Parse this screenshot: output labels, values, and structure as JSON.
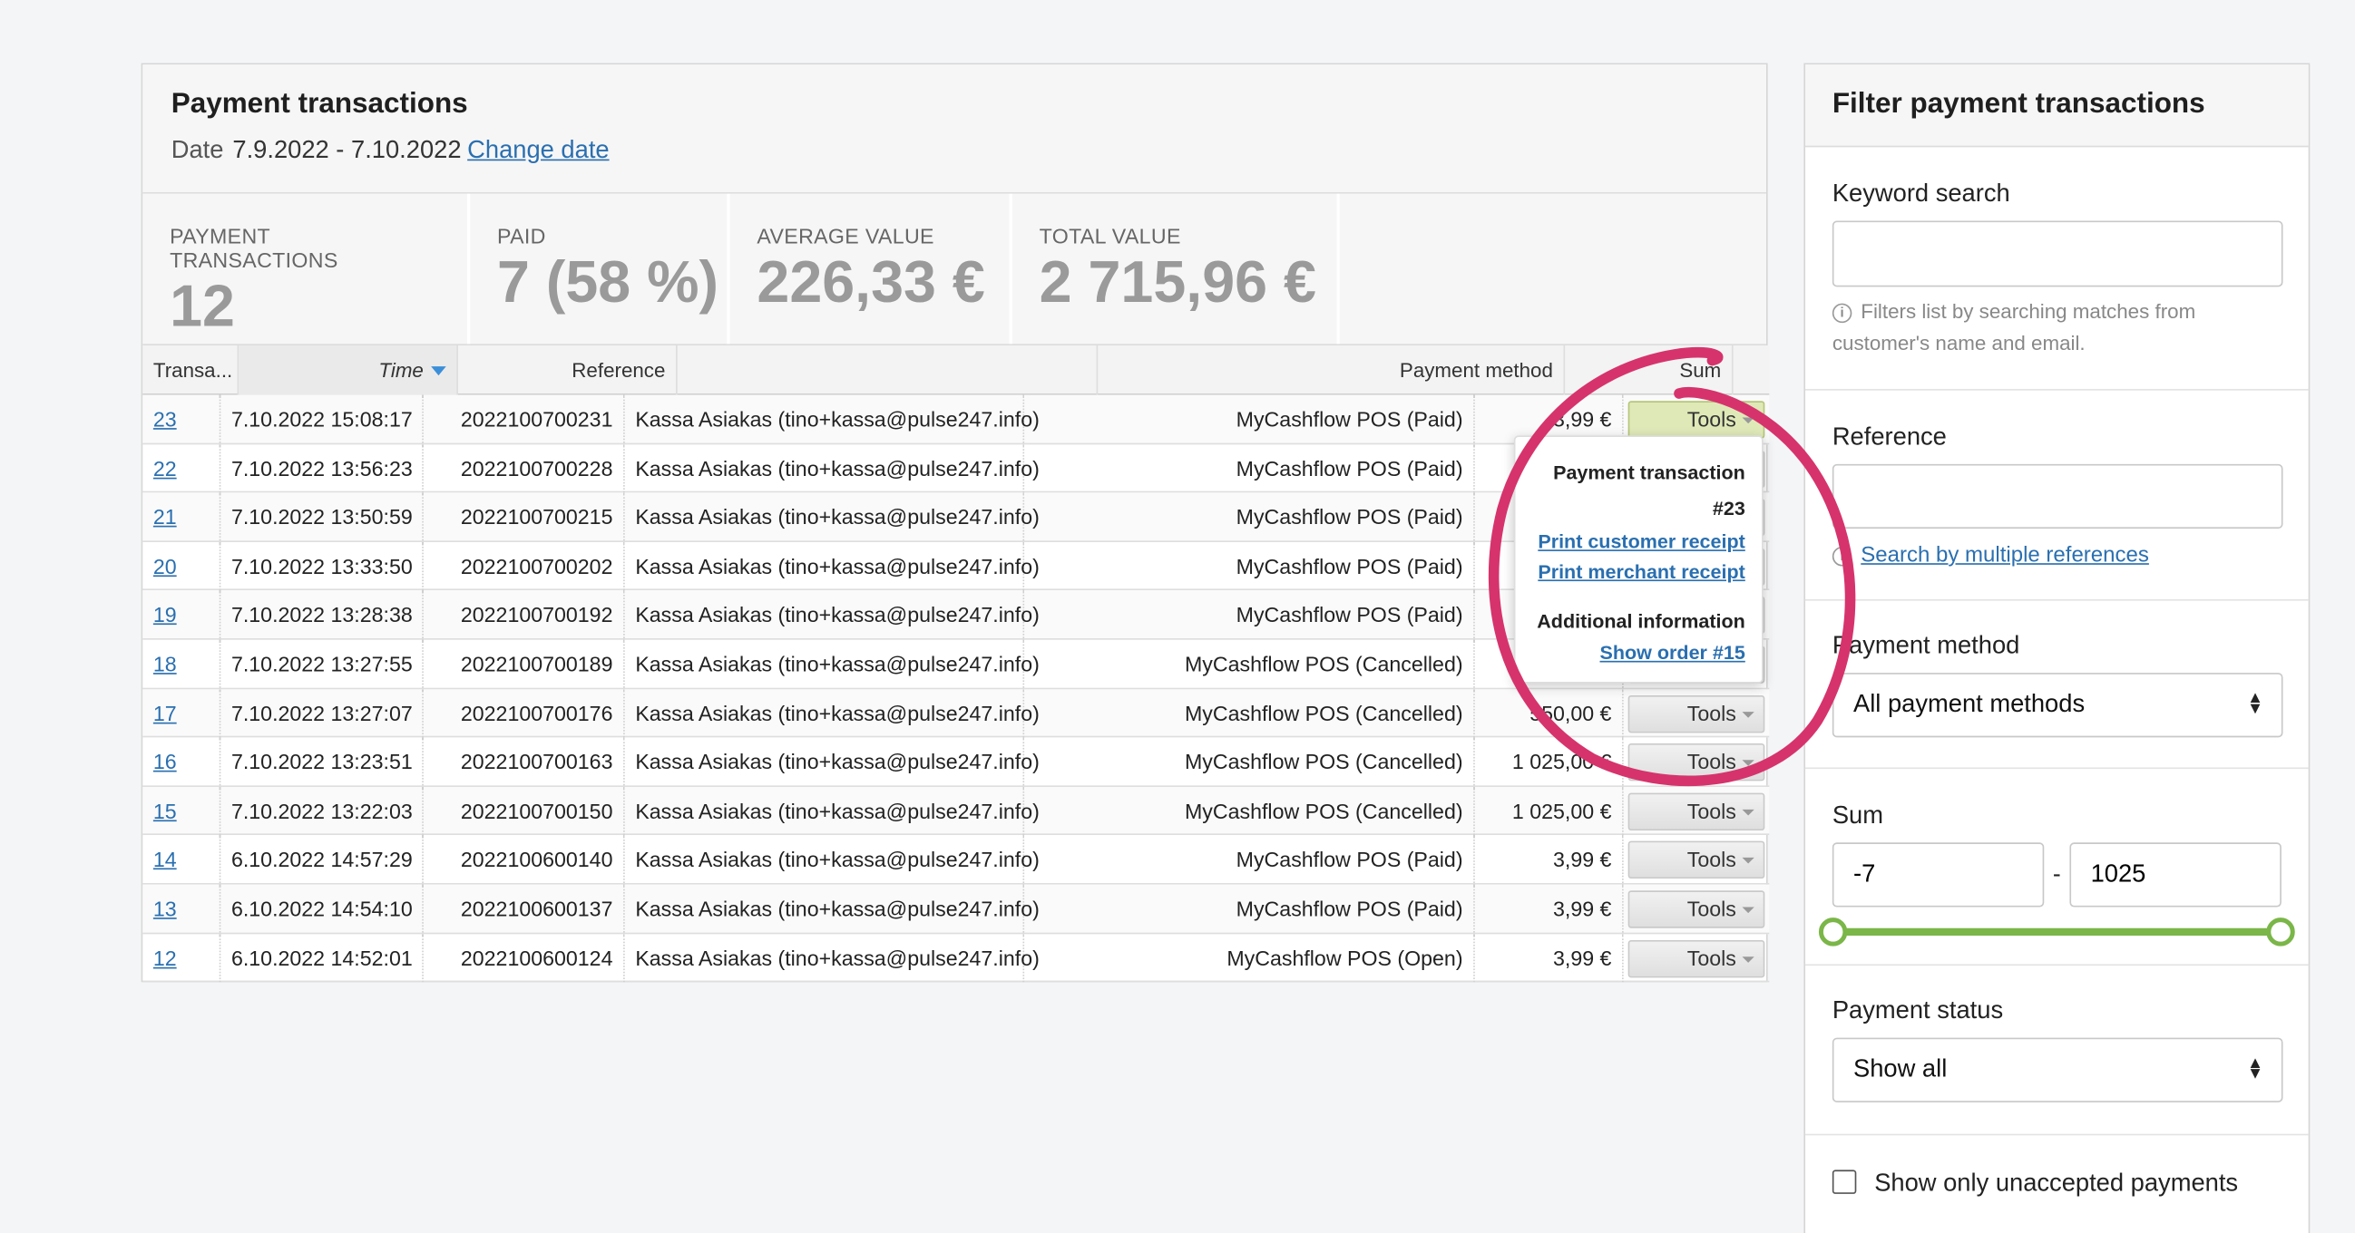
{
  "header": {
    "title": "Payment transactions",
    "date_label": "Date",
    "date_range": "7.9.2022 - 7.10.2022",
    "change_date": "Change date"
  },
  "stats": [
    {
      "label": "PAYMENT TRANSACTIONS",
      "value": "12"
    },
    {
      "label": "PAID",
      "value": "7 (58 %)"
    },
    {
      "label": "AVERAGE VALUE",
      "value": "226,33 €"
    },
    {
      "label": "TOTAL VALUE",
      "value": "2 715,96 €"
    }
  ],
  "table": {
    "headers": {
      "id": "Transa...",
      "time": "Time",
      "reference": "Reference",
      "payment_method": "Payment method",
      "sum": "Sum"
    },
    "tools_label": "Tools",
    "rows": [
      {
        "id": "23",
        "time": "7.10.2022 15:08:17",
        "reference": "2022100700231",
        "customer": "Kassa Asiakas (tino+kassa@pulse247.info)",
        "method": "MyCashflow POS (Paid)",
        "sum": "3,99 €"
      },
      {
        "id": "22",
        "time": "7.10.2022 13:56:23",
        "reference": "2022100700228",
        "customer": "Kassa Asiakas (tino+kassa@pulse247.info)",
        "method": "MyCashflow POS (Paid)",
        "sum": ""
      },
      {
        "id": "21",
        "time": "7.10.2022 13:50:59",
        "reference": "2022100700215",
        "customer": "Kassa Asiakas (tino+kassa@pulse247.info)",
        "method": "MyCashflow POS (Paid)",
        "sum": ""
      },
      {
        "id": "20",
        "time": "7.10.2022 13:33:50",
        "reference": "2022100700202",
        "customer": "Kassa Asiakas (tino+kassa@pulse247.info)",
        "method": "MyCashflow POS (Paid)",
        "sum": ""
      },
      {
        "id": "19",
        "time": "7.10.2022 13:28:38",
        "reference": "2022100700192",
        "customer": "Kassa Asiakas (tino+kassa@pulse247.info)",
        "method": "MyCashflow POS (Paid)",
        "sum": ""
      },
      {
        "id": "18",
        "time": "7.10.2022 13:27:55",
        "reference": "2022100700189",
        "customer": "Kassa Asiakas (tino+kassa@pulse247.info)",
        "method": "MyCashflow POS (Cancelled)",
        "sum": ""
      },
      {
        "id": "17",
        "time": "7.10.2022 13:27:07",
        "reference": "2022100700176",
        "customer": "Kassa Asiakas (tino+kassa@pulse247.info)",
        "method": "MyCashflow POS (Cancelled)",
        "sum": "550,00 €"
      },
      {
        "id": "16",
        "time": "7.10.2022 13:23:51",
        "reference": "2022100700163",
        "customer": "Kassa Asiakas (tino+kassa@pulse247.info)",
        "method": "MyCashflow POS (Cancelled)",
        "sum": "1 025,00 €"
      },
      {
        "id": "15",
        "time": "7.10.2022 13:22:03",
        "reference": "2022100700150",
        "customer": "Kassa Asiakas (tino+kassa@pulse247.info)",
        "method": "MyCashflow POS (Cancelled)",
        "sum": "1 025,00 €"
      },
      {
        "id": "14",
        "time": "6.10.2022 14:57:29",
        "reference": "2022100600140",
        "customer": "Kassa Asiakas (tino+kassa@pulse247.info)",
        "method": "MyCashflow POS (Paid)",
        "sum": "3,99 €"
      },
      {
        "id": "13",
        "time": "6.10.2022 14:54:10",
        "reference": "2022100600137",
        "customer": "Kassa Asiakas (tino+kassa@pulse247.info)",
        "method": "MyCashflow POS (Paid)",
        "sum": "3,99 €"
      },
      {
        "id": "12",
        "time": "6.10.2022 14:52:01",
        "reference": "2022100600124",
        "customer": "Kassa Asiakas (tino+kassa@pulse247.info)",
        "method": "MyCashflow POS (Open)",
        "sum": "3,99 €"
      }
    ]
  },
  "popup": {
    "title": "Payment transaction",
    "number": "#23",
    "print_customer": "Print customer receipt",
    "print_merchant": "Print merchant receipt",
    "additional": "Additional information",
    "show_order": "Show order #15"
  },
  "filter": {
    "title": "Filter payment transactions",
    "keyword_label": "Keyword search",
    "keyword_value": "",
    "keyword_hint": "Filters list by searching matches from customer's name and email.",
    "reference_label": "Reference",
    "reference_value": "",
    "multiple_refs": "Search by multiple references",
    "method_label": "Payment method",
    "method_value": "All payment methods",
    "sum_label": "Sum",
    "sum_min": "-7",
    "sum_sep": "-",
    "sum_max": "1025",
    "status_label": "Payment status",
    "status_value": "Show all",
    "unaccepted_label": "Show only unaccepted payments"
  },
  "colors": {
    "link": "#2a6fb0",
    "accent_green": "#7ab648",
    "annotation": "#d6336c"
  },
  "icons": [
    "sort-down-icon",
    "dropdown-arrow-icon",
    "info-icon",
    "select-arrows-icon",
    "checkbox-icon"
  ]
}
